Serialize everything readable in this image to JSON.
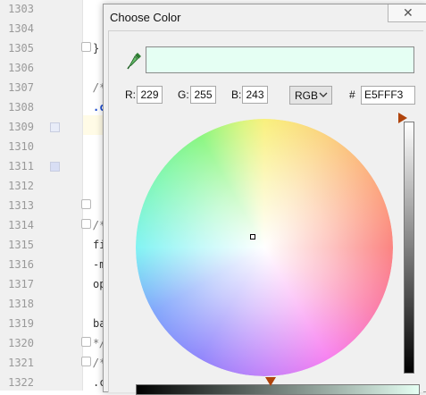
{
  "editor": {
    "lines": [
      {
        "num": "1303",
        "code": "",
        "kind": ""
      },
      {
        "num": "1304",
        "code": "",
        "kind": ""
      },
      {
        "num": "1305",
        "code": "}",
        "kind": ""
      },
      {
        "num": "1306",
        "code": "",
        "kind": ""
      },
      {
        "num": "1307",
        "code": "/*",
        "kind": "comment"
      },
      {
        "num": "1308",
        "code": ".c",
        "kind": "dot"
      },
      {
        "num": "1309",
        "code": "",
        "kind": ""
      },
      {
        "num": "1310",
        "code": "",
        "kind": ""
      },
      {
        "num": "1311",
        "code": "",
        "kind": ""
      },
      {
        "num": "1312",
        "code": "",
        "kind": ""
      },
      {
        "num": "1313",
        "code": "",
        "kind": ""
      },
      {
        "num": "1314",
        "code": "/*",
        "kind": "comment"
      },
      {
        "num": "1315",
        "code": "fi",
        "kind": ""
      },
      {
        "num": "1316",
        "code": "-m",
        "kind": ""
      },
      {
        "num": "1317",
        "code": "op",
        "kind": ""
      },
      {
        "num": "1318",
        "code": "",
        "kind": ""
      },
      {
        "num": "1319",
        "code": "ba",
        "kind": ""
      },
      {
        "num": "1320",
        "code": "*/",
        "kind": "comment"
      },
      {
        "num": "1321",
        "code": "/*",
        "kind": "comment"
      },
      {
        "num": "1322",
        "code": ".c",
        "kind": ""
      }
    ]
  },
  "dialog": {
    "title": "Choose Color",
    "close_glyph": "✕",
    "icons": {
      "eyedropper": "eyedropper-icon",
      "close": "close-icon",
      "chevron": "chevron-down-icon"
    },
    "preview_color": "#E5FFF3",
    "r_label": "R:",
    "r_value": "229",
    "g_label": "G:",
    "g_value": "255",
    "b_label": "B:",
    "b_value": "243",
    "mode": "RGB",
    "hash_label": "#",
    "hex_value": "E5FFF3",
    "brightness_value": 1.0
  }
}
